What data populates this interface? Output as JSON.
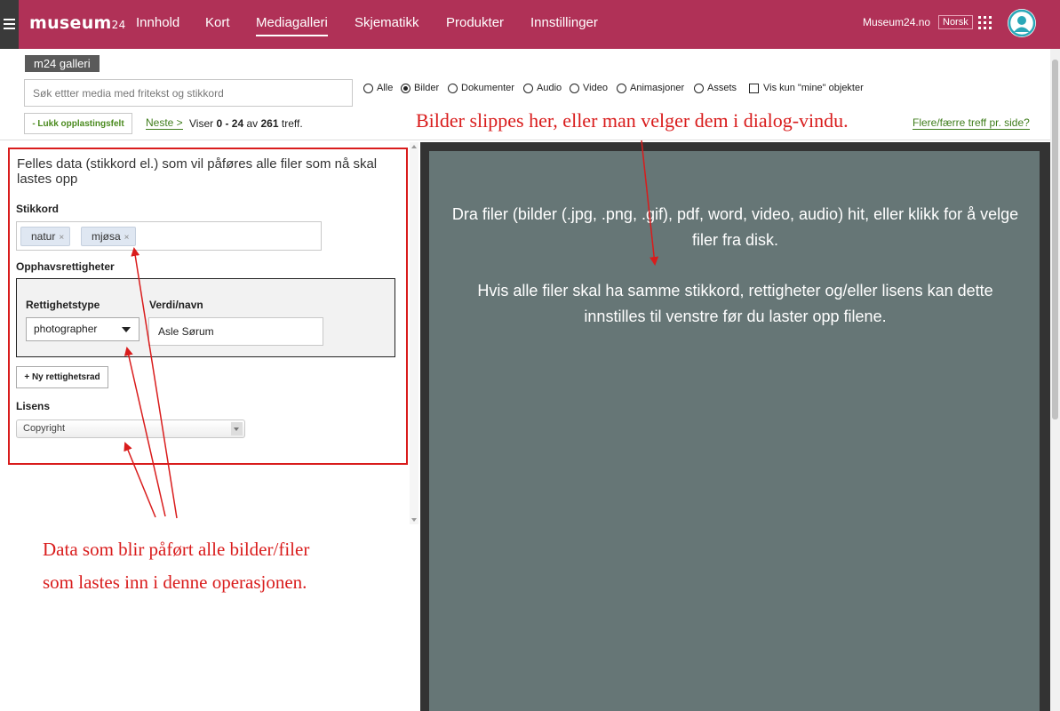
{
  "header": {
    "logo_text": "museum",
    "logo_suffix": "24",
    "nav": [
      "Innhold",
      "Kort",
      "Mediagalleri",
      "Skjematikk",
      "Produkter",
      "Innstillinger"
    ],
    "active_nav": "Mediagalleri",
    "site_link": "Museum24.no",
    "language": "Norsk",
    "icons": [
      "menu-icon",
      "apps-grid-icon",
      "user-avatar-icon"
    ],
    "accent_color": "#b03157"
  },
  "toolbar": {
    "gallery_label": "m24 galleri",
    "search_placeholder": "Søk ettter media med fritekst og stikkord",
    "filters": [
      {
        "label": "Alle",
        "checked": false
      },
      {
        "label": "Bilder",
        "checked": true
      },
      {
        "label": "Dokumenter",
        "checked": false
      },
      {
        "label": "Audio",
        "checked": false
      },
      {
        "label": "Video",
        "checked": false
      },
      {
        "label": "Animasjoner",
        "checked": false
      },
      {
        "label": "Assets",
        "checked": false
      }
    ],
    "mine_only_label": "Vis kun \"mine\" objekter",
    "mine_only_checked": false,
    "close_upload_label": "- Lukk opplastingsfelt",
    "next_label": "Neste >",
    "result_prefix": "Viser ",
    "result_range": "0 - 24",
    "result_mid": " av ",
    "result_total": "261",
    "result_suffix": " treff.",
    "more_results_label": "Flere/færre treff pr. side?"
  },
  "form": {
    "title": "Felles data (stikkord el.) som vil påføres alle filer som nå skal lastes opp",
    "keywords_label": "Stikkord",
    "tags": [
      "natur",
      "mjøsa"
    ],
    "tag_remove": "×",
    "rights_label": "Opphavsrettigheter",
    "rights_type_label": "Rettighetstype",
    "rights_value_label": "Verdi/navn",
    "rights_type_value": "photographer",
    "rights_value": "Asle Sørum",
    "new_row_label": "+ Ny rettighetsrad",
    "license_label": "Lisens",
    "license_value": "Copyright",
    "frame_color": "#d91c1c"
  },
  "dropzone": {
    "line1": "Dra filer (bilder (.jpg, .png, .gif), pdf, word, video, audio) hit, eller klikk for å velge filer fra disk.",
    "line2": "Hvis alle filer skal ha samme stikkord, rettigheter og/eller lisens kan dette innstilles til venstre før du laster opp filene.",
    "background_color": "#667676"
  },
  "annotations": {
    "top": "Bilder slippes her, eller man velger dem i dialog-vindu.",
    "bottom_line1": "Data som blir påført alle bilder/filer",
    "bottom_line2": "som lastes inn i denne operasjonen.",
    "color": "#d91c1c"
  }
}
